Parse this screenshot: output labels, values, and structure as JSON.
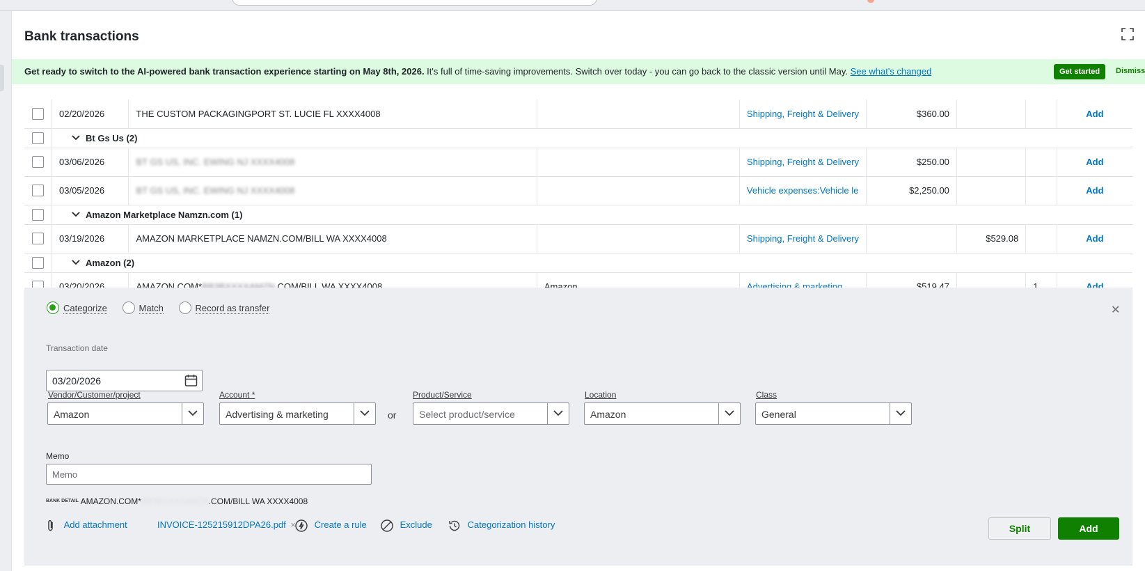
{
  "page": {
    "title": "Bank transactions"
  },
  "banner": {
    "bold_text": "Get ready to switch to the AI-powered bank transaction experience starting on May 8th, 2026.",
    "text": " It's full of time-saving improvements. Switch over today - you can go back to the classic version until May. ",
    "link": "See what's changed",
    "get_started": "Get started",
    "dismiss": "Dismiss"
  },
  "rows": [
    {
      "date": "02/20/2026",
      "description": "THE CUSTOM PACKAGINGPORT ST. LUCIE FL XXXX4008",
      "payee": "",
      "category": "Shipping, Freight & Delivery",
      "spent": "$360.00",
      "received": "",
      "num": "",
      "action": "Add"
    }
  ],
  "groups": [
    {
      "label": "Bt Gs Us (2)",
      "rows": [
        {
          "date": "03/06/2026",
          "description": "BT GS US, INC. EWING NJ XXXX4008",
          "payee": "",
          "category": "Shipping, Freight & Delivery",
          "spent": "$250.00",
          "received": "",
          "num": "",
          "action": "Add"
        },
        {
          "date": "03/05/2026",
          "description": "BT GS US, INC. EWING NJ XXXX4008",
          "payee": "",
          "category": "Vehicle expenses:Vehicle le",
          "spent": "$2,250.00",
          "received": "",
          "num": "",
          "action": "Add"
        }
      ]
    },
    {
      "label": "Amazon Marketplace Namzn.com (1)",
      "rows": [
        {
          "date": "03/19/2026",
          "description": "AMAZON MARKETPLACE NAMZN.COM/BILL WA XXXX4008",
          "payee": "",
          "category": "Shipping, Freight & Delivery",
          "spent": "",
          "received": "$529.08",
          "num": "",
          "action": "Add"
        }
      ]
    },
    {
      "label": "Amazon (2)",
      "rows": [
        {
          "date": "03/20/2026",
          "description_prefix": "AMAZON.COM*",
          "description_blur": "BB3BXXXXAMZN",
          "description_suffix": ".COM/BILL WA XXXX4008",
          "payee": "Amazon",
          "category": "Advertising & marketing",
          "spent": "$519.47",
          "received": "",
          "num": "1",
          "action": "Add"
        }
      ]
    }
  ],
  "detail": {
    "radios": [
      "Categorize",
      "Match",
      "Record as transfer"
    ],
    "selected_radio": "Categorize",
    "transaction_date_label": "Transaction date",
    "transaction_date": "03/20/2026",
    "vendor_label": "Vendor/Customer/project",
    "vendor_value": "Amazon",
    "account_label": "Account *",
    "account_value": "Advertising & marketing",
    "or_text": "or",
    "product_label": "Product/Service",
    "product_placeholder": "Select product/service",
    "location_label": "Location",
    "location_value": "Amazon",
    "class_label": "Class",
    "class_value": "General",
    "memo_label": "Memo",
    "memo_placeholder": "Memo",
    "bank_detail_tag": "BANK DETAIL",
    "bank_detail_prefix": "AMAZON.COM*",
    "bank_detail_blur": "BB3BXXXXAMZN",
    "bank_detail_suffix": ".COM/BILL WA XXXX4008",
    "add_attachment": "Add attachment",
    "attachment_file": "INVOICE-125215912DPA26.pdf",
    "create_rule": "Create a rule",
    "exclude": "Exclude",
    "categorization_history": "Categorization history",
    "split_label": "Split",
    "add_label": "Add"
  },
  "colors": {
    "brand_green": "#108000",
    "link_blue": "#0077c5",
    "banner_bg": "#dcfbe1",
    "detail_bg": "#eceef1"
  }
}
